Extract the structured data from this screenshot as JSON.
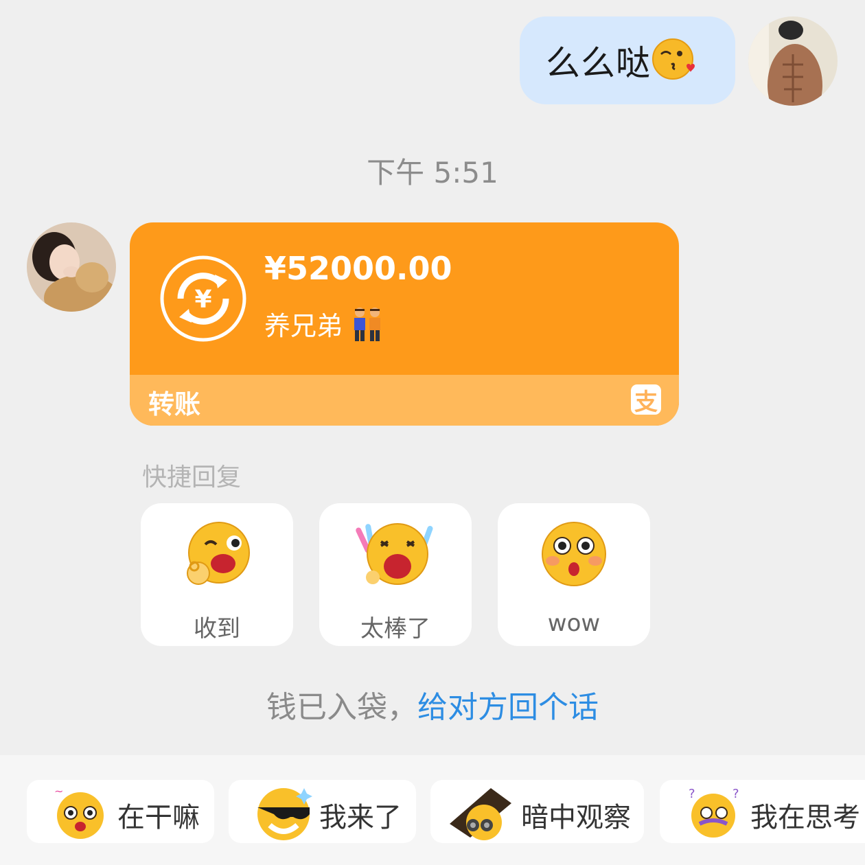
{
  "outgoing_message": {
    "text": "么么哒"
  },
  "timestamp": "下午 5:51",
  "transfer": {
    "amount": "¥52000.00",
    "note": "养兄弟",
    "footer_label": "转账",
    "badge": "支"
  },
  "quick_reply": {
    "title": "快捷回复",
    "items": [
      {
        "label": "收到",
        "icon": "ok-wink-emoji-icon"
      },
      {
        "label": "太棒了",
        "icon": "cheering-emoji-icon"
      },
      {
        "label": "wow",
        "icon": "surprised-emoji-icon"
      }
    ]
  },
  "hint": {
    "static_text": "钱已入袋，",
    "link_text": "给对方回个话"
  },
  "stickers": [
    {
      "label": "在干嘛",
      "icon": "what-are-you-doing-sticker-icon"
    },
    {
      "label": "我来了",
      "icon": "sunglasses-emoji-icon"
    },
    {
      "label": "暗中观察",
      "icon": "peeking-binoculars-icon"
    },
    {
      "label": "我在思考",
      "icon": "thinking-sticker-icon"
    }
  ],
  "colors": {
    "card_orange": "#fe9a1a",
    "card_footer": "#ffb95a",
    "link_blue": "#2d8de3",
    "bubble_blue": "#d6e8fd"
  }
}
